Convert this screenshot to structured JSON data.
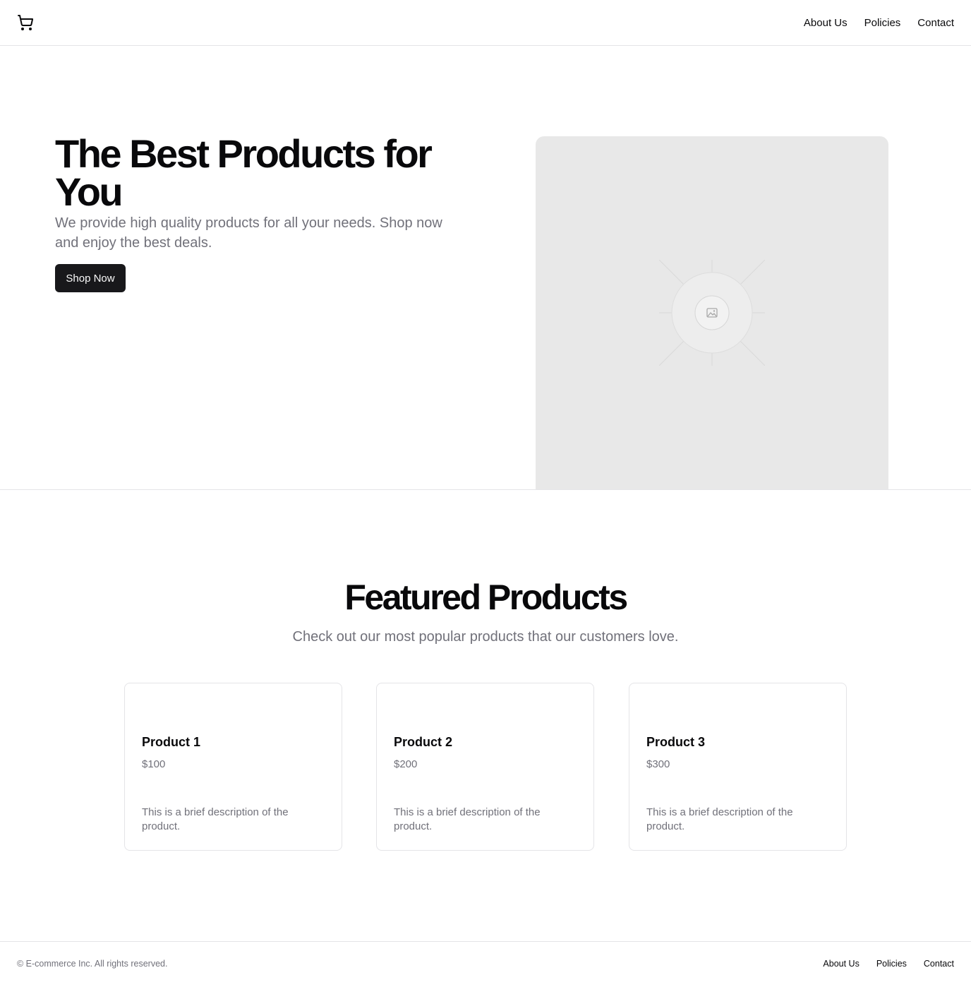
{
  "header": {
    "logo_icon": "shopping-cart-icon",
    "nav": [
      "About Us",
      "Policies",
      "Contact"
    ]
  },
  "hero": {
    "title": "The Best Products for You",
    "subtitle": "We provide high quality products for all your needs. Shop now and enjoy the best deals.",
    "cta_label": "Shop Now",
    "image_icon": "image-placeholder-icon"
  },
  "featured": {
    "title": "Featured Products",
    "subtitle": "Check out our most popular products that our customers love.",
    "products": [
      {
        "name": "Product 1",
        "price": "$100",
        "description": "This is a brief description of the product."
      },
      {
        "name": "Product 2",
        "price": "$200",
        "description": "This is a brief description of the product."
      },
      {
        "name": "Product 3",
        "price": "$300",
        "description": "This is a brief description of the product."
      }
    ]
  },
  "footer": {
    "copyright": "© E-commerce Inc. All rights reserved.",
    "nav": [
      "About Us",
      "Policies",
      "Contact"
    ]
  },
  "colors": {
    "primary": "#18181b",
    "muted_text": "#71717a",
    "border": "#e4e4e7",
    "placeholder_bg": "#e8e8e8"
  }
}
